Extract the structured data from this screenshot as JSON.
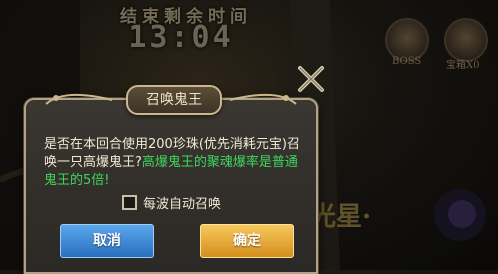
{
  "hud": {
    "timer_label": "结束剩余时间",
    "timer_value": "13:04",
    "medal_boss_label": "BOSS",
    "medal_treasure_label": "宝箱X0",
    "side_text": "光星·"
  },
  "dialog": {
    "title": "召唤鬼王",
    "message_part1": "是否在本回合使用200珍珠(优先消耗元宝)召唤一只高爆鬼王?",
    "message_highlight": "高爆鬼王的聚魂爆率是普通鬼王的5倍!",
    "checkbox_label": "每波自动召唤",
    "checkbox_checked": false,
    "cancel_label": "取消",
    "confirm_label": "确定"
  },
  "colors": {
    "highlight_text": "#3fd65d",
    "cancel_button": "#3b86d6",
    "confirm_button": "#e8a934"
  }
}
